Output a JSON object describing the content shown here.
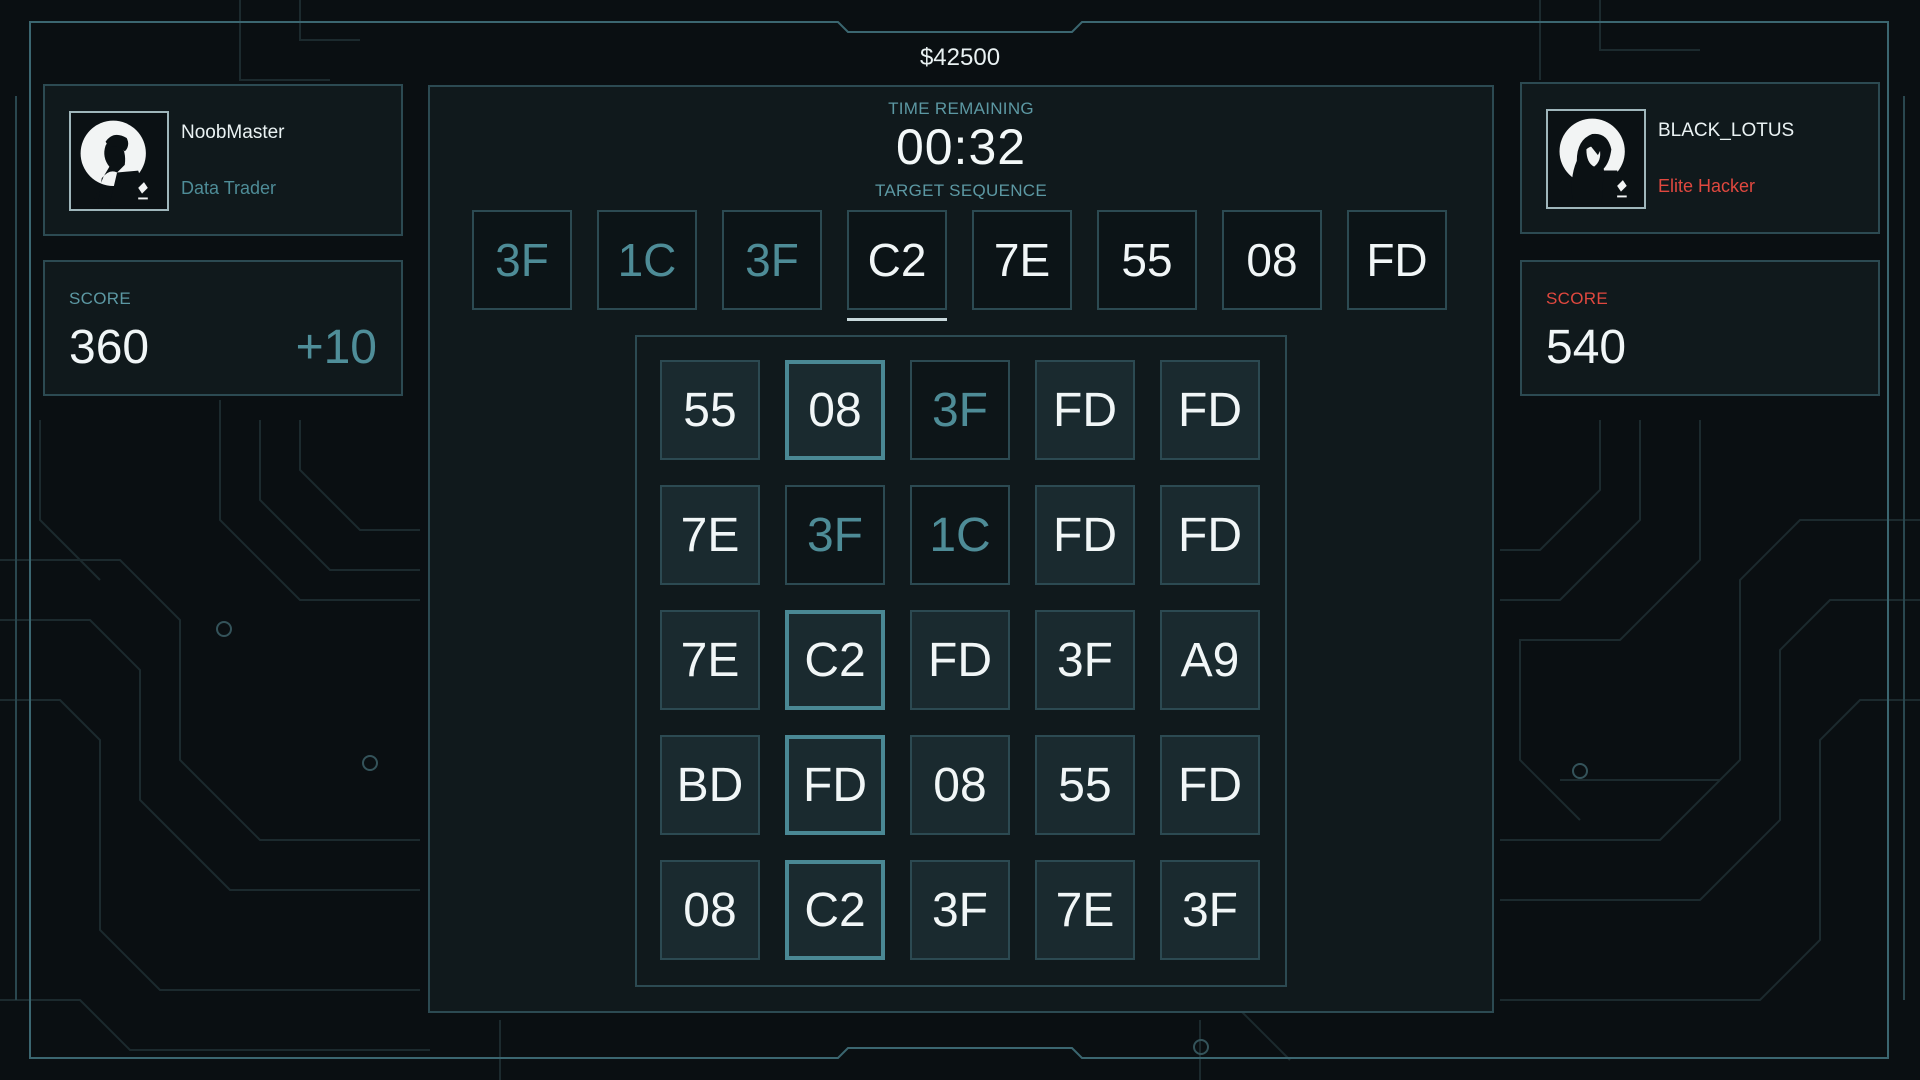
{
  "money": "$42500",
  "timer": {
    "label": "TIME REMAINING",
    "value": "00:32"
  },
  "target": {
    "label": "TARGET SEQUENCE",
    "codes": [
      "3F",
      "1C",
      "3F",
      "C2",
      "7E",
      "55",
      "08",
      "FD"
    ],
    "completed_count": 3,
    "current_index": 3
  },
  "player": {
    "name": "NoobMaster",
    "role": "Data Trader",
    "score_label": "SCORE",
    "score": "360",
    "delta": "+10"
  },
  "opponent": {
    "name": "BLACK_LOTUS",
    "role": "Elite Hacker",
    "score_label": "SCORE",
    "score": "540"
  },
  "grid": [
    [
      {
        "v": "55"
      },
      {
        "v": "08",
        "sel": true
      },
      {
        "v": "3F",
        "used": true
      },
      {
        "v": "FD"
      },
      {
        "v": "FD"
      }
    ],
    [
      {
        "v": "7E"
      },
      {
        "v": "3F",
        "used": true
      },
      {
        "v": "1C",
        "used": true
      },
      {
        "v": "FD"
      },
      {
        "v": "FD"
      }
    ],
    [
      {
        "v": "7E"
      },
      {
        "v": "C2",
        "sel": true
      },
      {
        "v": "FD"
      },
      {
        "v": "3F"
      },
      {
        "v": "A9"
      }
    ],
    [
      {
        "v": "BD"
      },
      {
        "v": "FD",
        "sel": true
      },
      {
        "v": "08"
      },
      {
        "v": "55"
      },
      {
        "v": "FD"
      }
    ],
    [
      {
        "v": "08"
      },
      {
        "v": "C2",
        "sel": true
      },
      {
        "v": "3F"
      },
      {
        "v": "7E"
      },
      {
        "v": "3F"
      }
    ]
  ],
  "colors": {
    "accent": "#4a8894",
    "opponent_accent": "#e0483f",
    "panel_border": "#2c4a52",
    "background": "#0a0f12"
  }
}
